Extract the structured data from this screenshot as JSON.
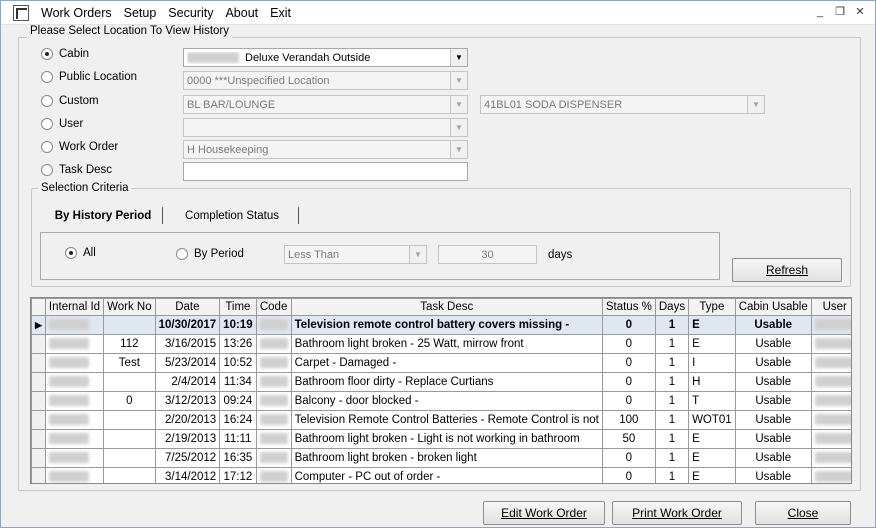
{
  "menu": [
    "Work Orders",
    "Setup",
    "Security",
    "About",
    "Exit"
  ],
  "window_controls": [
    "_",
    "ͦ",
    "x"
  ],
  "location_group": {
    "legend": "Please Select Location To View History",
    "options": [
      {
        "label": "Cabin",
        "checked": true,
        "value": "Deluxe Verandah Outside",
        "enabled": true
      },
      {
        "label": "Public Location",
        "checked": false,
        "value": "0000  ***Unspecified Location",
        "enabled": false
      },
      {
        "label": "Custom",
        "checked": false,
        "value": "BL  BAR/LOUNGE",
        "value2": "41BL01  SODA DISPENSER",
        "enabled": false
      },
      {
        "label": "User",
        "checked": false,
        "value": "",
        "enabled": false
      },
      {
        "label": "Work Order",
        "checked": false,
        "value": "H Housekeeping",
        "enabled": false
      },
      {
        "label": "Task Desc",
        "checked": false,
        "value": "",
        "enabled": true
      }
    ]
  },
  "selection_group": {
    "legend": "Selection Criteria",
    "tabs": [
      "By History Period",
      "Completion Status"
    ],
    "radio_all": "All",
    "radio_period": "By Period",
    "period_op": "Less Than",
    "period_value": "30",
    "period_unit": "days",
    "refresh_label": "Refresh"
  },
  "grid": {
    "columns": [
      "Internal Id",
      "Work No",
      "Date",
      "Time",
      "Code",
      "Task Desc",
      "Status %",
      "Days",
      "Type",
      "Cabin Usable",
      "User"
    ],
    "rows": [
      {
        "work_no": "",
        "date": "10/30/2017",
        "time": "10:19",
        "task": "Television remote control battery covers missing -",
        "status": "0",
        "days": "1",
        "type": "E",
        "usable": "Usable"
      },
      {
        "work_no": "112",
        "date": "3/16/2015",
        "time": "13:26",
        "task": "Bathroom light broken - 25 Watt, mirrow front",
        "status": "0",
        "days": "1",
        "type": "E",
        "usable": "Usable"
      },
      {
        "work_no": "Test",
        "date": "5/23/2014",
        "time": "10:52",
        "task": "Carpet - Damaged -",
        "status": "0",
        "days": "1",
        "type": "I",
        "usable": "Usable"
      },
      {
        "work_no": "",
        "date": "2/4/2014",
        "time": "11:34",
        "task": "Bathroom floor dirty - Replace Curtians",
        "status": "0",
        "days": "1",
        "type": "H",
        "usable": "Usable"
      },
      {
        "work_no": "0",
        "date": "3/12/2013",
        "time": "09:24",
        "task": "Balcony - door blocked -",
        "status": "0",
        "days": "1",
        "type": "T",
        "usable": "Usable"
      },
      {
        "work_no": "",
        "date": "2/20/2013",
        "time": "16:24",
        "task": "Television Remote Control Batteries - Remote Control is not",
        "status": "100",
        "days": "1",
        "type": "WOT01",
        "usable": "Usable"
      },
      {
        "work_no": "",
        "date": "2/19/2013",
        "time": "11:11",
        "task": "Bathroom light broken - Light is not working in bathroom",
        "status": "50",
        "days": "1",
        "type": "E",
        "usable": "Usable"
      },
      {
        "work_no": "",
        "date": "7/25/2012",
        "time": "16:35",
        "task": "Bathroom light broken - broken light",
        "status": "0",
        "days": "1",
        "type": "E",
        "usable": "Usable"
      },
      {
        "work_no": "",
        "date": "3/14/2012",
        "time": "17:12",
        "task": "Computer - PC out of order -",
        "status": "0",
        "days": "1",
        "type": "E",
        "usable": "Usable"
      }
    ]
  },
  "buttons": {
    "edit": "Edit Work Order",
    "print": "Print Work Order",
    "close": "Close"
  }
}
